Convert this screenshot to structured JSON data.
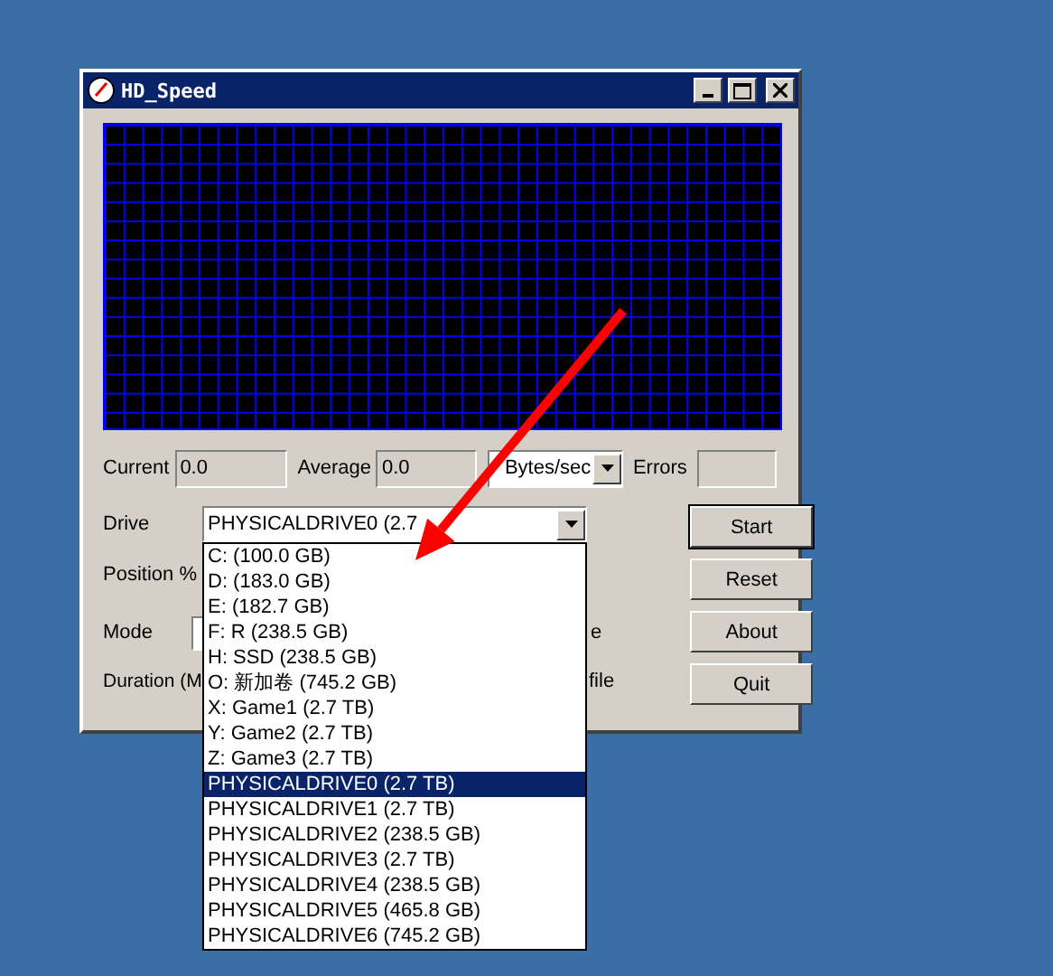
{
  "window": {
    "title": "HD_Speed"
  },
  "stats": [
    {
      "label": "Current",
      "value": "0.0"
    },
    {
      "label": "Average",
      "value": "0.0"
    }
  ],
  "unit": "Bytes/sec",
  "errors": {
    "label": "Errors"
  },
  "labels": {
    "drive": "Drive",
    "position": "Position %",
    "mode": "Mode",
    "duration": "Duration (M",
    "mode_side": "e",
    "duration_side": "file"
  },
  "drive": {
    "value": "PHYSICALDRIVE0 (2.7",
    "options": [
      {
        "label": "C: (100.0 GB)",
        "selected": false
      },
      {
        "label": "D: (183.0 GB)",
        "selected": false
      },
      {
        "label": "E: (182.7 GB)",
        "selected": false
      },
      {
        "label": "F: R (238.5 GB)",
        "selected": false
      },
      {
        "label": "H: SSD (238.5 GB)",
        "selected": false
      },
      {
        "label": "O: 新加卷 (745.2 GB)",
        "selected": false
      },
      {
        "label": "X: Game1 (2.7 TB)",
        "selected": false
      },
      {
        "label": "Y: Game2 (2.7 TB)",
        "selected": false
      },
      {
        "label": "Z: Game3 (2.7 TB)",
        "selected": false
      },
      {
        "label": "PHYSICALDRIVE0 (2.7 TB)",
        "selected": true
      },
      {
        "label": "PHYSICALDRIVE1 (2.7 TB)",
        "selected": false
      },
      {
        "label": "PHYSICALDRIVE2 (238.5 GB)",
        "selected": false
      },
      {
        "label": "PHYSICALDRIVE3 (2.7 TB)",
        "selected": false
      },
      {
        "label": "PHYSICALDRIVE4 (238.5 GB)",
        "selected": false
      },
      {
        "label": "PHYSICALDRIVE5 (465.8 GB)",
        "selected": false
      },
      {
        "label": "PHYSICALDRIVE6 (745.2 GB)",
        "selected": false
      }
    ]
  },
  "buttons": [
    {
      "label": "Start",
      "default": true
    },
    {
      "label": "Reset",
      "default": false
    },
    {
      "label": "About",
      "default": false
    },
    {
      "label": "Quit",
      "default": false
    }
  ]
}
